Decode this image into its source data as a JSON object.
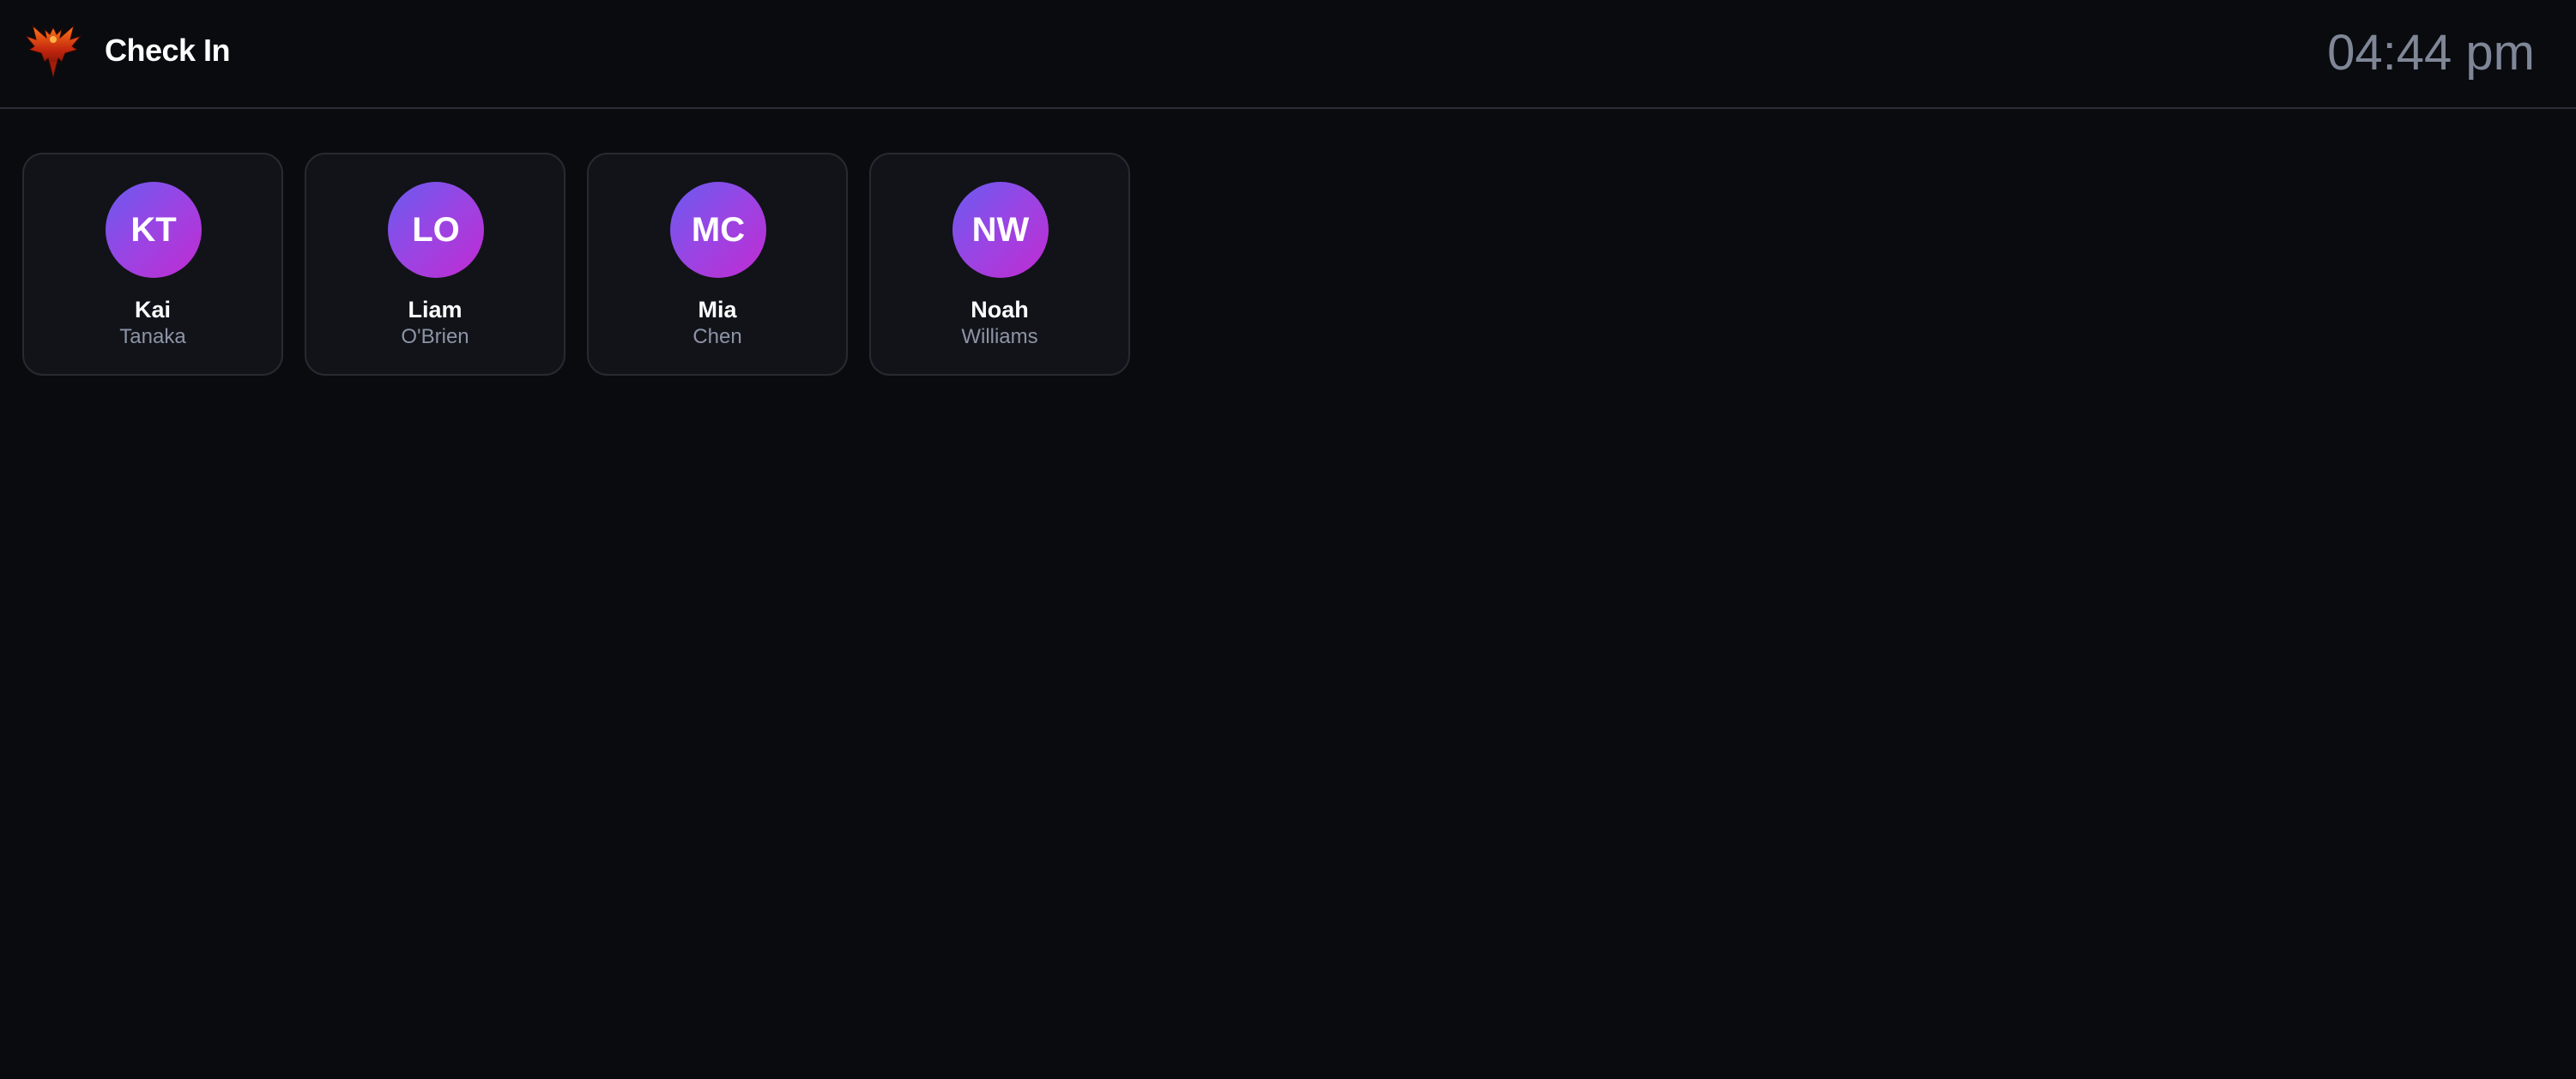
{
  "header": {
    "title": "Check In",
    "clock": "04:44 pm",
    "logo_icon": "phoenix-logo-icon"
  },
  "colors": {
    "background": "#0a0b0f",
    "card_background": "#111318",
    "card_border": "#272a31",
    "avatar_gradient_start": "#6a5bf0",
    "avatar_gradient_end": "#c02bd1",
    "clock_text": "#7f8797",
    "last_name_text": "#8c94a6"
  },
  "people": [
    {
      "initials": "KT",
      "first_name": "Kai",
      "last_name": "Tanaka"
    },
    {
      "initials": "LO",
      "first_name": "Liam",
      "last_name": "O'Brien"
    },
    {
      "initials": "MC",
      "first_name": "Mia",
      "last_name": "Chen"
    },
    {
      "initials": "NW",
      "first_name": "Noah",
      "last_name": "Williams"
    }
  ]
}
